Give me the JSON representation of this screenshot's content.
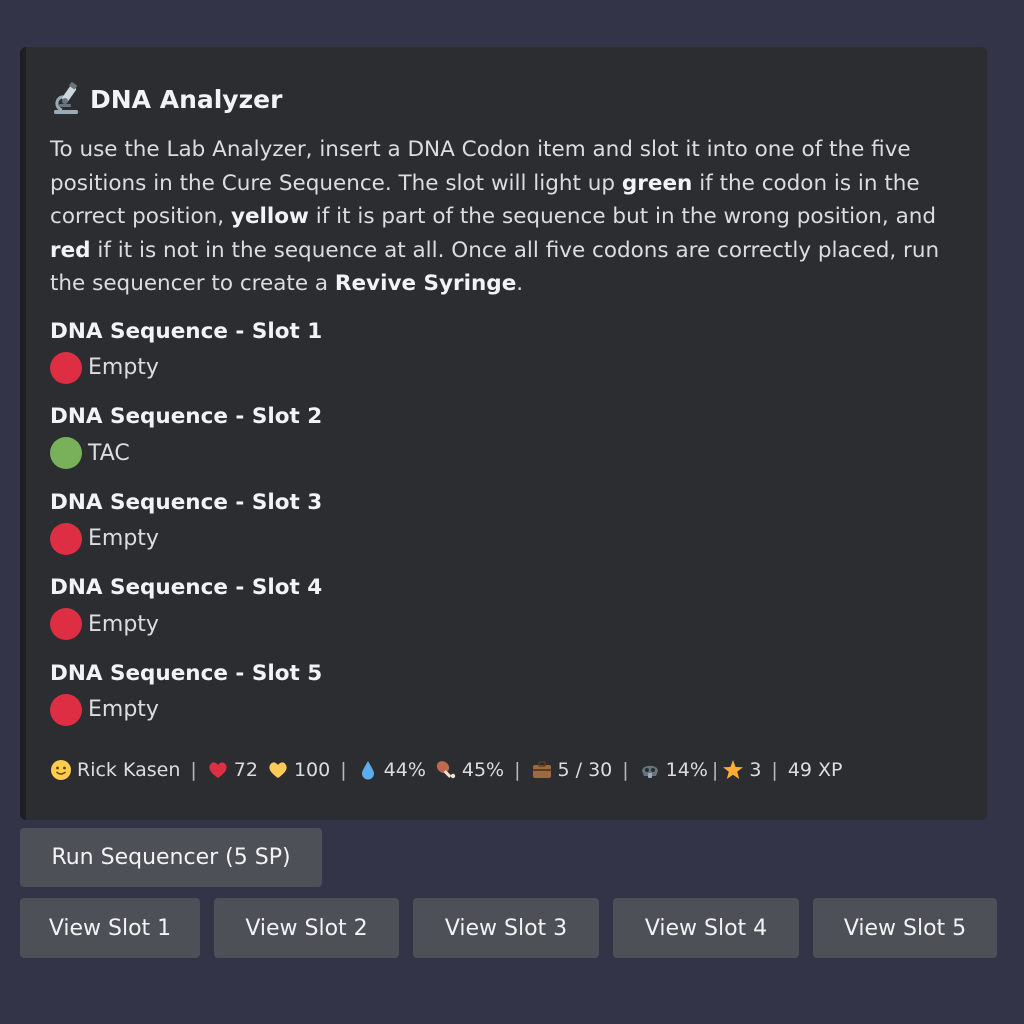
{
  "embed": {
    "title": "DNA Analyzer",
    "title_icon": "microscope-icon",
    "description": {
      "p1": "To use the Lab Analyzer, insert a DNA Codon item and slot it into one of the five positions in the Cure Sequence. The slot will light up ",
      "green": "green",
      "p2": " if the codon is in the correct position, ",
      "yellow": "yellow",
      "p3": " if it is part of the sequence but in the wrong position, and ",
      "red": "red",
      "p4": " if it is not in the sequence at all. Once all five codons are correctly placed, run the sequencer to create a ",
      "item": "Revive Syringe",
      "p5": "."
    },
    "fields": [
      {
        "name": "DNA Sequence - Slot 1",
        "value": "Empty",
        "status_color": "#dd2e44"
      },
      {
        "name": "DNA Sequence - Slot 2",
        "value": "TAC",
        "status_color": "#78b159"
      },
      {
        "name": "DNA Sequence - Slot 3",
        "value": "Empty",
        "status_color": "#dd2e44"
      },
      {
        "name": "DNA Sequence - Slot 4",
        "value": "Empty",
        "status_color": "#dd2e44"
      },
      {
        "name": "DNA Sequence - Slot 5",
        "value": "Empty",
        "status_color": "#dd2e44"
      }
    ],
    "footer": {
      "player": "Rick Kasen",
      "health": "72",
      "gold": "100",
      "water": "44%",
      "food": "45%",
      "inventory": "5 / 30",
      "radiation": "14%",
      "level": "3",
      "xp": "49 XP",
      "separator": "|"
    }
  },
  "buttons": {
    "run": "Run Sequencer (5 SP)",
    "slots": [
      "View Slot 1",
      "View Slot 2",
      "View Slot 3",
      "View Slot 4",
      "View Slot 5"
    ]
  },
  "colors": {
    "background": "#343448",
    "embed": "#2b2d31",
    "button": "#4e5058",
    "red": "#dd2e44",
    "green": "#78b159"
  }
}
